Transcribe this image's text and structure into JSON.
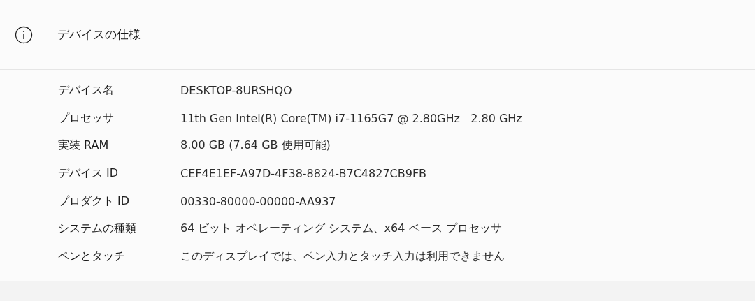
{
  "section": {
    "title": "デバイスの仕様"
  },
  "specs": [
    {
      "label": "デバイス名",
      "value": "DESKTOP-8URSHQO"
    },
    {
      "label": "プロセッサ",
      "value": "11th Gen Intel(R) Core(TM) i7-1165G7 @ 2.80GHz   2.80 GHz"
    },
    {
      "label": "実装 RAM",
      "value": "8.00 GB (7.64 GB 使用可能)"
    },
    {
      "label": "デバイス ID",
      "value": "CEF4E1EF-A97D-4F38-8824-B7C4827CB9FB"
    },
    {
      "label": "プロダクト ID",
      "value": "00330-80000-00000-AA937"
    },
    {
      "label": "システムの種類",
      "value": "64 ビット オペレーティング システム、x64 ベース プロセッサ"
    },
    {
      "label": "ペンとタッチ",
      "value": "このディスプレイでは、ペン入力とタッチ入力は利用できません"
    }
  ]
}
